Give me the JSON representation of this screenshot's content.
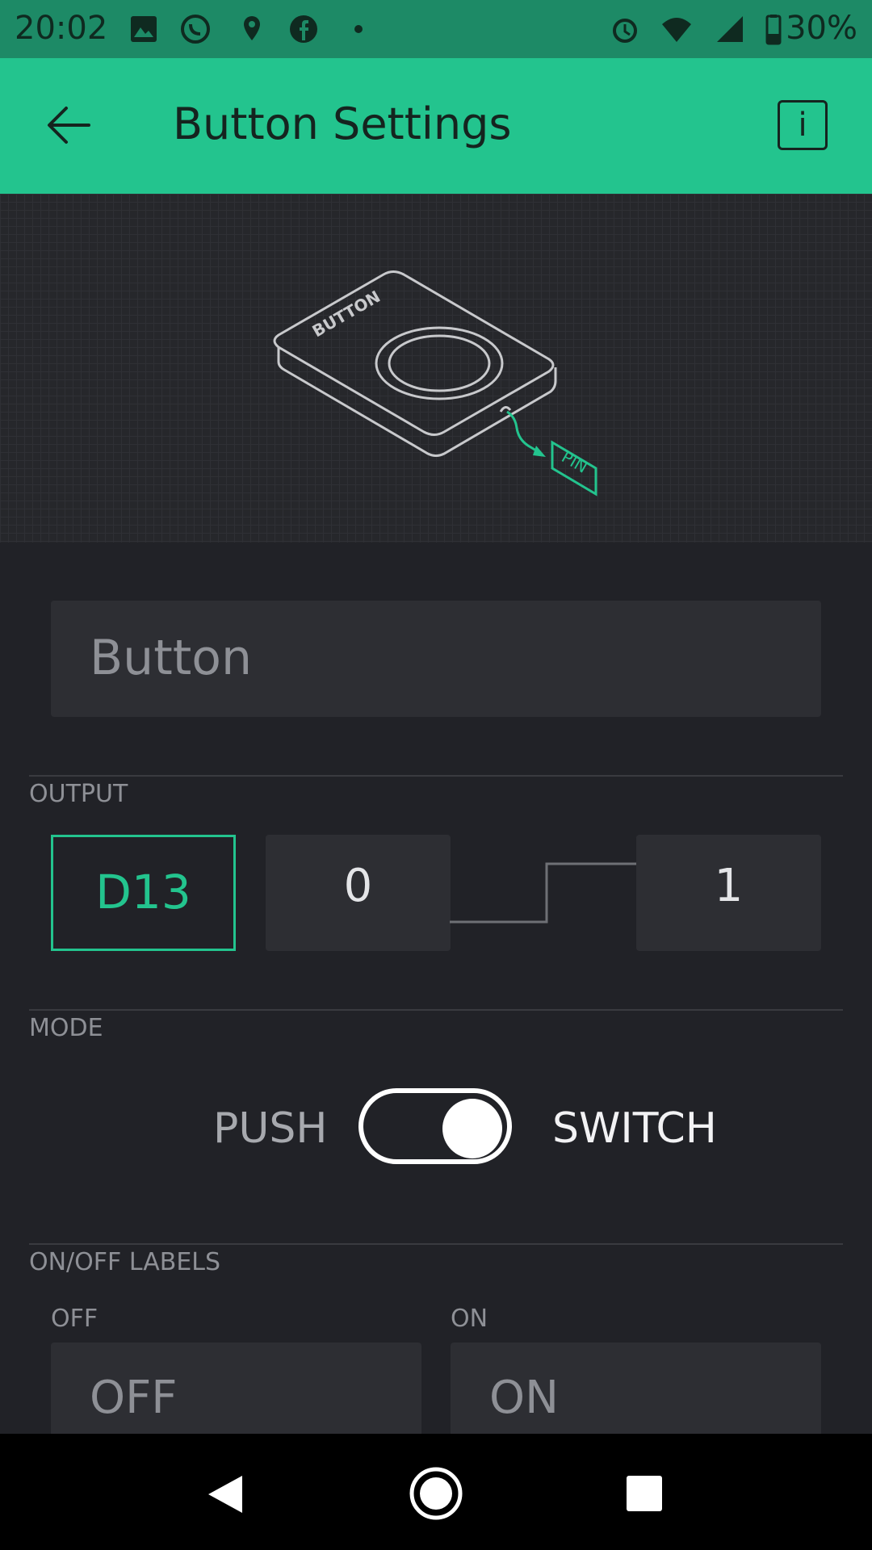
{
  "status_bar": {
    "time": "20:02",
    "battery": "30%",
    "icons": [
      "image-icon",
      "whatsapp-icon",
      "location-pin-icon",
      "facebook-icon",
      "dot-icon",
      "alarm-icon",
      "wifi-icon",
      "signal-icon",
      "battery-icon"
    ]
  },
  "appbar": {
    "title": "Button Settings",
    "info_label": "i"
  },
  "illustration": {
    "button_text": "BUTTON",
    "pin_text": "PIN"
  },
  "name_field": {
    "value": "Button"
  },
  "output": {
    "section_label": "OUTPUT",
    "pin": "D13",
    "low_value": "0",
    "high_value": "1"
  },
  "mode": {
    "section_label": "MODE",
    "push_label": "PUSH",
    "switch_label": "SWITCH",
    "selected": "SWITCH"
  },
  "onoff": {
    "section_label": "ON/OFF LABELS",
    "off_label": "OFF",
    "on_label": "ON",
    "off_value": "OFF",
    "on_value": "ON"
  },
  "colors": {
    "accent": "#23c48e",
    "status_bar": "#1d8a66",
    "background": "#212227"
  }
}
